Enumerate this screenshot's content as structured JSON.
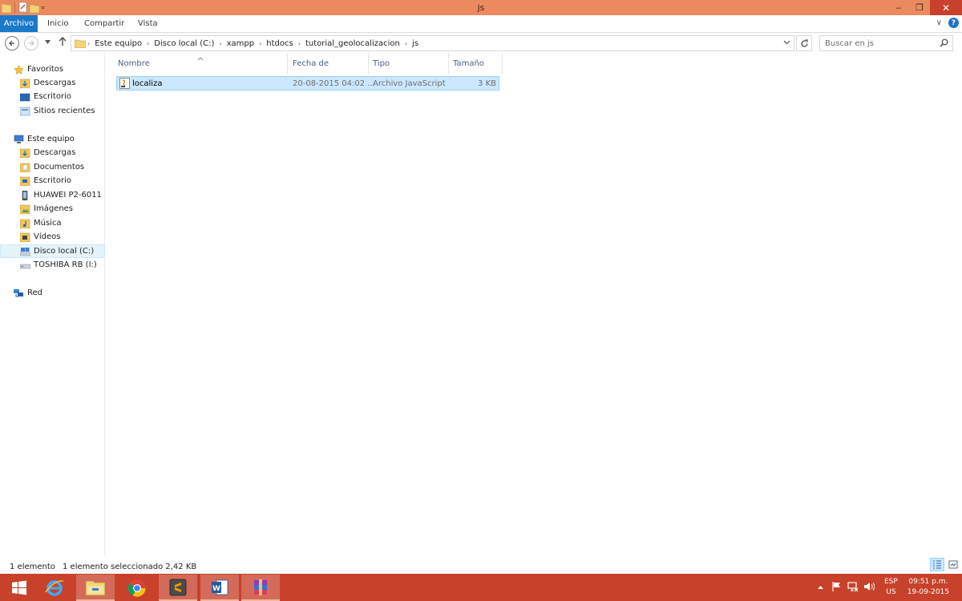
{
  "window": {
    "title": "js",
    "controls": {
      "minimize": "‒",
      "maximize": "❐",
      "close": "✕"
    }
  },
  "ribbon": {
    "tabs": [
      "Archivo",
      "Inicio",
      "Compartir",
      "Vista"
    ],
    "expand_glyph": "∨",
    "help_glyph": "?"
  },
  "address": {
    "breadcrumbs": [
      "Este equipo",
      "Disco local (C:)",
      "xampp",
      "htdocs",
      "tutorial_geolocalizacion",
      "js"
    ],
    "search_placeholder": "Buscar en js"
  },
  "navpane": {
    "favorites": {
      "label": "Favoritos",
      "items": [
        "Descargas",
        "Escritorio",
        "Sitios recientes"
      ]
    },
    "computer": {
      "label": "Este equipo",
      "items": [
        "Descargas",
        "Documentos",
        "Escritorio",
        "HUAWEI P2-6011",
        "Imágenes",
        "Música",
        "Vídeos",
        "Disco local (C:)",
        "TOSHIBA RB (I:)"
      ]
    },
    "network": {
      "label": "Red"
    },
    "selected": "Disco local (C:)"
  },
  "filelist": {
    "columns": [
      "Nombre",
      "Fecha de modifica...",
      "Tipo",
      "Tamaño"
    ],
    "rows": [
      {
        "name": "localiza",
        "date": "20-08-2015 04:02 ...",
        "type": "Archivo JavaScript",
        "size": "3 KB"
      }
    ]
  },
  "status": {
    "count": "1 elemento",
    "selection": "1 elemento seleccionado  2,42 KB"
  },
  "taskbar": {
    "apps": [
      "start",
      "internet-explorer",
      "file-explorer",
      "chrome",
      "sublime-text",
      "word",
      "winrar"
    ],
    "active_app": "file-explorer",
    "language": "ESP",
    "layout": "US",
    "time": "09:51 p.m.",
    "date": "19-09-2015"
  },
  "colors": {
    "titlebar": "#ec8a5f",
    "taskbar": "#c8412b",
    "accent": "#1979ca",
    "selection": "#cce8ff"
  }
}
